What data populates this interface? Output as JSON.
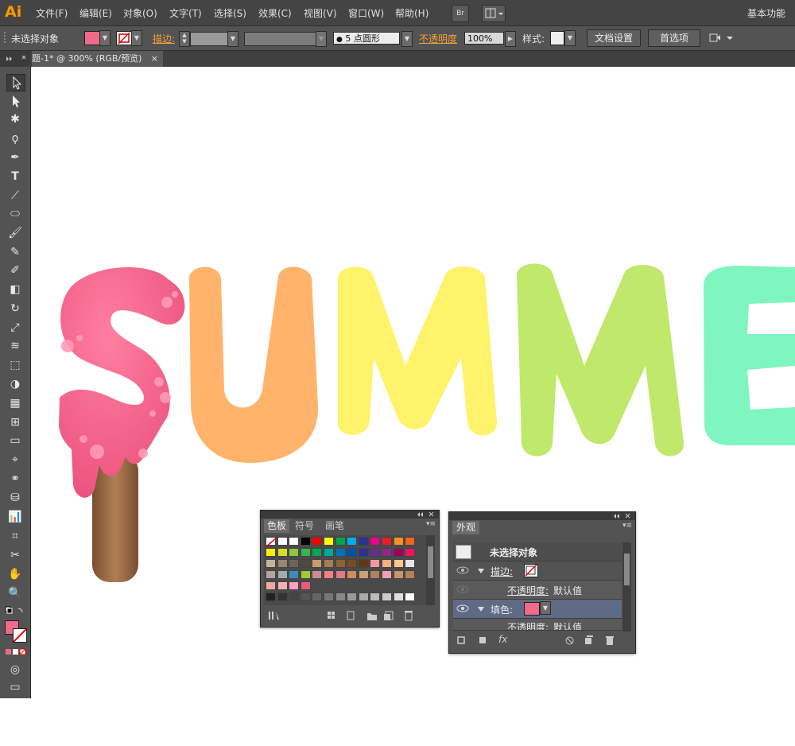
{
  "app": {
    "logo": "Ai"
  },
  "menu": [
    "文件(F)",
    "编辑(E)",
    "对象(O)",
    "文字(T)",
    "选择(S)",
    "效果(C)",
    "视图(V)",
    "窗口(W)",
    "帮助(H)"
  ],
  "menubar": {
    "bridge_label": "Br",
    "workspace": "基本功能"
  },
  "control": {
    "selection_label": "未选择对象",
    "stroke_label": "描边:",
    "brush_value": "5 点圆形",
    "opacity_label": "不透明度",
    "opacity_value": "100%",
    "style_label": "样式:",
    "doc_setup": "文档设置",
    "prefs": "首选项"
  },
  "document": {
    "tab_title": "题-1* @ 300% (RGB/预览)",
    "close": "×"
  },
  "artwork": {
    "letters": [
      "S",
      "U",
      "M",
      "M",
      "E"
    ]
  },
  "swatches_panel": {
    "tabs": [
      "色板",
      "符号",
      "画笔"
    ],
    "rows": [
      [
        "#ffffff",
        "#ffffff",
        "#ffffff",
        "#000000",
        "#ff0000",
        "#ffff00",
        "#00a650",
        "#00aeef",
        "#2e3192",
        "#ec008c",
        "#ed1c24",
        "#f7941d",
        "#f26522"
      ],
      [
        "#fff200",
        "#d7df23",
        "#8dc63f",
        "#39b54a",
        "#00a651",
        "#00a99d",
        "#0072bc",
        "#0054a6",
        "#2e3192",
        "#662d91",
        "#92278f",
        "#9e005d",
        "#ed145b"
      ],
      [
        "#c7b299",
        "#998675",
        "#736357",
        "#534741",
        "#c69c6d",
        "#a67c52",
        "#8c6239",
        "#754c24",
        "#603913",
        "#f5989d",
        "#f9ad81",
        "#fdc68a",
        "#e6e6e6"
      ],
      [
        "#b1a5a0",
        "#a7a9ac",
        "#3c8dbc",
        "#9acd32",
        "#cd8c95",
        "#f08080",
        "#e07a8a",
        "#d08c60",
        "#c8a078",
        "#b08060",
        "#f0a0b0",
        "#c8946c",
        "#b4825a"
      ],
      [
        "#f4a6a0",
        "#f9b0b0",
        "#f7a1c4",
        "#ea5a7d"
      ]
    ],
    "gray_row": [
      "#222222",
      "#333333",
      "#444444",
      "#555555",
      "#666666",
      "#777777",
      "#888888",
      "#999999",
      "#aaaaaa",
      "#bbbbbb",
      "#cccccc",
      "#dddddd",
      "#ffffff"
    ]
  },
  "appearance_panel": {
    "tab": "外观",
    "header": "未选择对象",
    "stroke_label": "描边:",
    "opacity_label": "不透明度:",
    "opacity_value": "默认值",
    "fill_label": "填色:",
    "opacity_label2": "不透明度:",
    "opacity_value2": "默认值",
    "fx_label": "fx"
  },
  "colors": {
    "fill_pink": "#f06a8a",
    "s_pink": "#f25c85",
    "u_orange": "#ffb36b",
    "m1_yellow": "#fff36b",
    "m2_green": "#c0e86a",
    "e_mint": "#7ff5c0",
    "stick_brown": "#9a6a45"
  }
}
